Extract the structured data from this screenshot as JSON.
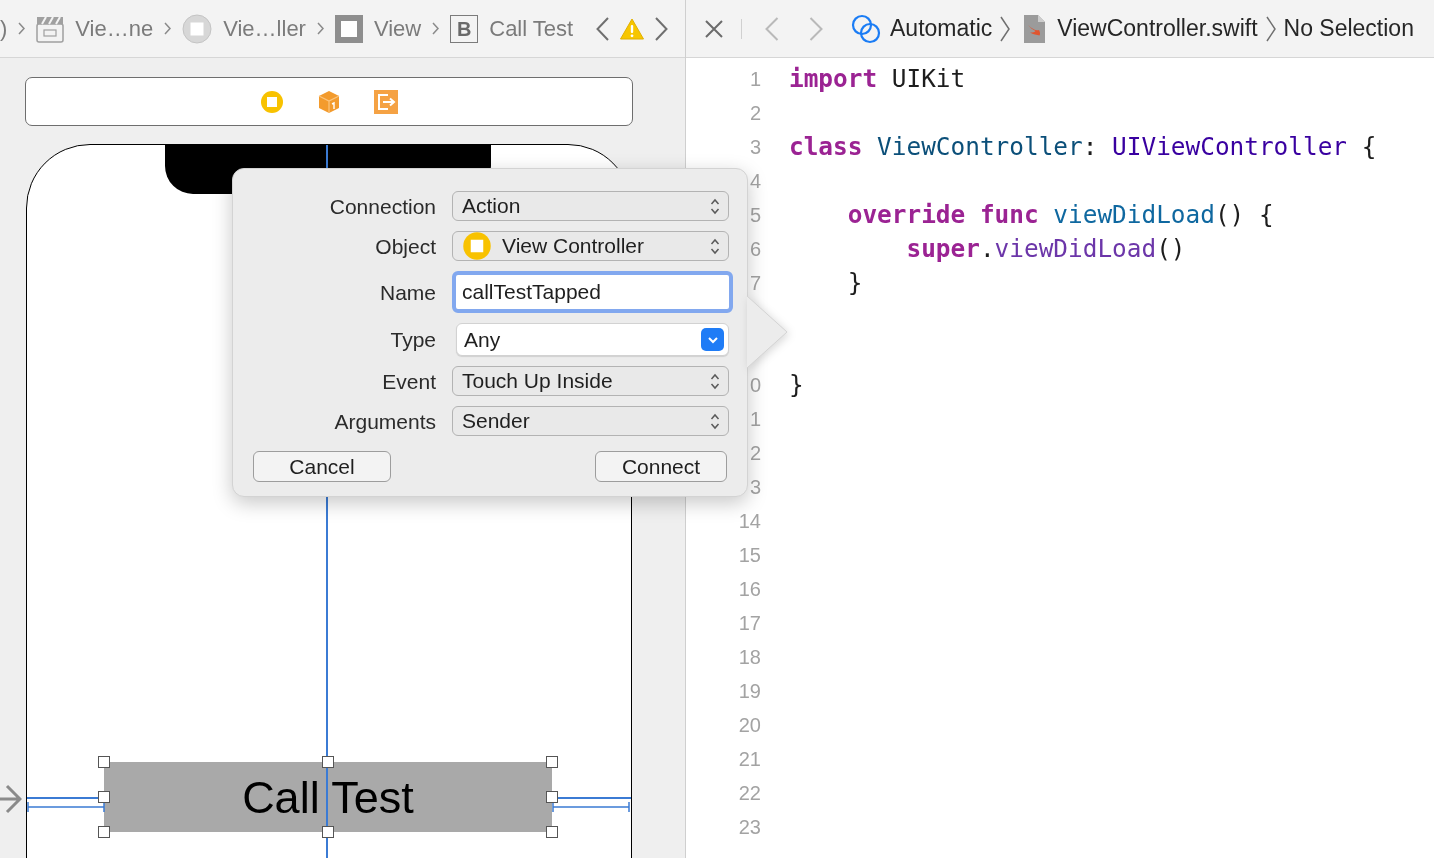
{
  "jump_bar": {
    "items": [
      {
        "kind": "text",
        "label": ")"
      },
      {
        "kind": "scene",
        "label": "Vie…ne"
      },
      {
        "kind": "view_controller",
        "label": "Vie…ller"
      },
      {
        "kind": "view",
        "label": "View"
      },
      {
        "kind": "button",
        "badge": "B",
        "label": "Call Test"
      }
    ]
  },
  "editor_bar": {
    "history": [
      {
        "kind": "back",
        "disabled": true
      },
      {
        "kind": "forward",
        "disabled": true
      }
    ],
    "related": "Automatic",
    "file": "ViewController.swift",
    "selection": "No Selection"
  },
  "canvas": {
    "button": {
      "label": "Call Test",
      "selected": true
    }
  },
  "popover": {
    "rows": [
      {
        "kind": "popup",
        "label": "Connection",
        "value": "Action"
      },
      {
        "kind": "object_popup",
        "label": "Object",
        "value": "View Controller"
      },
      {
        "kind": "text_field",
        "label": "Name",
        "value": "callTestTapped",
        "focused": true
      },
      {
        "kind": "combo_box",
        "label": "Type",
        "value": "Any"
      },
      {
        "kind": "popup",
        "label": "Event",
        "value": "Touch Up Inside"
      },
      {
        "kind": "popup",
        "label": "Arguments",
        "value": "Sender"
      }
    ],
    "buttons": [
      {
        "label": "Cancel"
      },
      {
        "label": "Connect"
      }
    ]
  },
  "editor": {
    "lines": [
      {
        "kind": "line",
        "number": "1",
        "tokens": [
          {
            "kind": "keyword",
            "text": "import"
          },
          {
            "kind": "plain",
            "text": " UIKit"
          }
        ]
      },
      {
        "kind": "line",
        "number": "2"
      },
      {
        "kind": "line",
        "number": "3",
        "tokens": [
          {
            "kind": "keyword",
            "text": "class"
          },
          {
            "kind": "type_declaration",
            "text": " ViewController"
          },
          {
            "kind": "plain",
            "text": ": "
          },
          {
            "kind": "type_reference",
            "text": "UIViewController"
          },
          {
            "kind": "plain",
            "text": " {"
          }
        ]
      },
      {
        "kind": "line",
        "number": "4"
      },
      {
        "kind": "line",
        "number": "5",
        "tokens": [
          {
            "kind": "keyword",
            "text": "    override"
          },
          {
            "kind": "keyword",
            "text": " func"
          },
          {
            "kind": "function_declaration",
            "text": " viewDidLoad"
          },
          {
            "kind": "plain",
            "text": "() {"
          }
        ]
      },
      {
        "kind": "line",
        "number": "6",
        "tokens": [
          {
            "kind": "keyword",
            "text": "        super"
          },
          {
            "kind": "plain",
            "text": "."
          },
          {
            "kind": "function_reference",
            "text": "viewDidLoad"
          },
          {
            "kind": "plain",
            "text": "()"
          }
        ]
      },
      {
        "kind": "line",
        "number": "7",
        "tokens": [
          {
            "kind": "plain",
            "text": "    }"
          }
        ]
      },
      {
        "kind": "covered"
      },
      {
        "kind": "covered"
      },
      {
        "kind": "line",
        "number": "0",
        "tokens": [
          {
            "kind": "plain",
            "text": "}"
          }
        ]
      },
      {
        "kind": "line",
        "number": "1"
      },
      {
        "kind": "line",
        "number": "2"
      },
      {
        "kind": "line",
        "number": "3"
      },
      {
        "kind": "line",
        "number": "14"
      },
      {
        "kind": "line",
        "number": "15"
      },
      {
        "kind": "line",
        "number": "16"
      },
      {
        "kind": "line",
        "number": "17"
      },
      {
        "kind": "line",
        "number": "18"
      },
      {
        "kind": "line",
        "number": "19"
      },
      {
        "kind": "line",
        "number": "20"
      },
      {
        "kind": "line",
        "number": "21"
      },
      {
        "kind": "line",
        "number": "22"
      },
      {
        "kind": "line",
        "number": "23"
      }
    ]
  }
}
